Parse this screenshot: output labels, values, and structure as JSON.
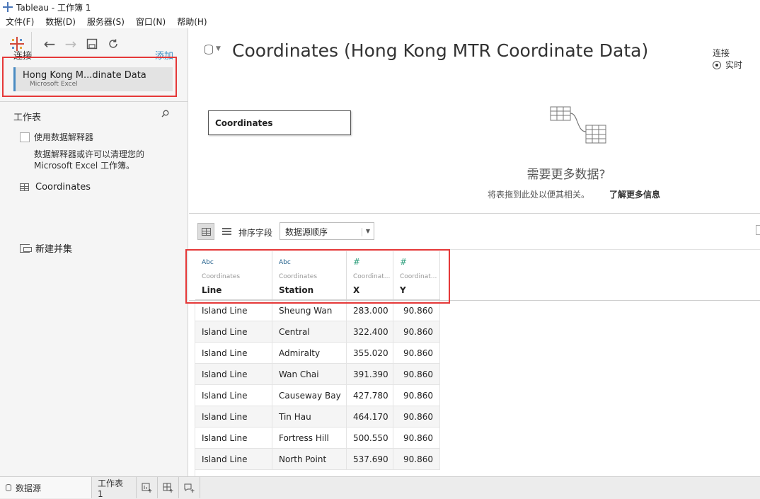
{
  "window": {
    "title": "Tableau - 工作簿 1"
  },
  "menu": [
    "文件(F)",
    "数据(D)",
    "服务器(S)",
    "窗口(N)",
    "帮助(H)"
  ],
  "connections": {
    "label": "连接",
    "add": "添加",
    "item": {
      "name": "Hong Kong M...dinate Data",
      "type": "Microsoft Excel"
    }
  },
  "sheets": {
    "label": "工作表",
    "interpreter_label": "使用数据解释器",
    "interpreter_desc_1": "数据解释器或许可以清理您的",
    "interpreter_desc_2": "Microsoft Excel 工作簿。",
    "items": [
      "Coordinates"
    ],
    "new_union": "新建并集"
  },
  "datasource": {
    "title": "Coordinates (Hong Kong MTR Coordinate Data)",
    "connection_label": "连接",
    "connection_mode": "实时",
    "table_name": "Coordinates",
    "need_more": "需要更多数据?",
    "drag_hint": "将表拖到此处以便其相关。",
    "learn_more": "了解更多信息"
  },
  "grid_controls": {
    "sort_label": "排序字段",
    "sort_value": "数据源顺序"
  },
  "grid": {
    "columns": [
      {
        "type": "Abc",
        "source": "Coordinates",
        "name": "Line"
      },
      {
        "type": "Abc",
        "source": "Coordinates",
        "name": "Station"
      },
      {
        "type": "#",
        "source": "Coordinat...",
        "name": "X"
      },
      {
        "type": "#",
        "source": "Coordinat...",
        "name": "Y"
      }
    ],
    "rows": [
      [
        "Island Line",
        "Sheung Wan",
        "283.000",
        "90.860"
      ],
      [
        "Island Line",
        "Central",
        "322.400",
        "90.860"
      ],
      [
        "Island Line",
        "Admiralty",
        "355.020",
        "90.860"
      ],
      [
        "Island Line",
        "Wan Chai",
        "391.390",
        "90.860"
      ],
      [
        "Island Line",
        "Causeway Bay",
        "427.780",
        "90.860"
      ],
      [
        "Island Line",
        "Tin Hau",
        "464.170",
        "90.860"
      ],
      [
        "Island Line",
        "Fortress Hill",
        "500.550",
        "90.860"
      ],
      [
        "Island Line",
        "North Point",
        "537.690",
        "90.860"
      ]
    ]
  },
  "tabs": {
    "datasource": "数据源",
    "sheet1": "工作表 1"
  },
  "colors": {
    "highlight_red": "#e53838",
    "accent_blue": "#4a8bc2",
    "number_green": "#2a9d7a"
  },
  "icons": [
    "tableau-logo-icon",
    "back-icon",
    "forward-icon",
    "save-icon",
    "refresh-icon",
    "search-icon",
    "grid-view-icon",
    "list-view-icon",
    "join-icon"
  ]
}
